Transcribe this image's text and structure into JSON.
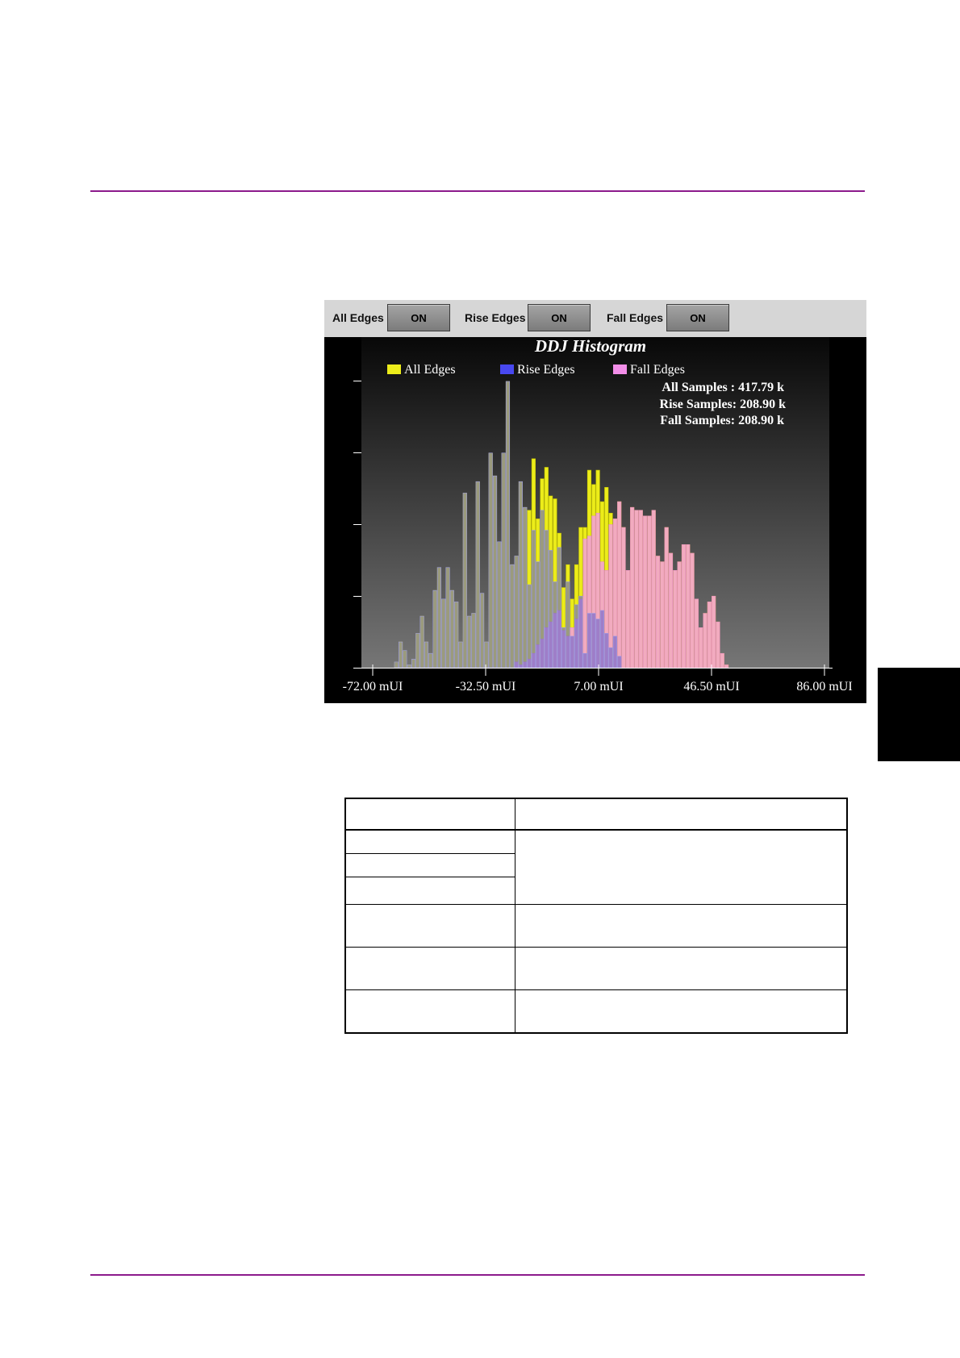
{
  "toolbar": {
    "items": [
      {
        "label": "All Edges",
        "button": "ON"
      },
      {
        "label": "Rise Edges",
        "button": "ON"
      },
      {
        "label": "Fall Edges",
        "button": "ON"
      }
    ]
  },
  "colors": {
    "all": "#ecec1a",
    "rise": "#5a5ad0",
    "fall": "#f2a8c8",
    "rule": "#8c1a8c"
  },
  "chart_data": {
    "type": "bar",
    "title": "DDJ Histogram",
    "xlabel": "",
    "ylabel": "",
    "xlim": [
      -72.0,
      86.0
    ],
    "x_ticks": [
      "-72.00 mUI",
      "-32.50 mUI",
      "7.00 mUI",
      "46.50 mUI",
      "86.00 mUI"
    ],
    "legend": {
      "placement": "top",
      "entries": [
        "All Edges",
        "Rise Edges",
        "Fall Edges"
      ]
    },
    "stats": [
      "All Samples : 417.79 k",
      "Rise Samples: 208.90 k",
      "Fall Samples: 208.90 k"
    ],
    "grid": false,
    "bin_start": -64.5,
    "bin_width": 1.5,
    "series": [
      {
        "name": "All Edges",
        "values": [
          2,
          9,
          6,
          1,
          3,
          12,
          18,
          9,
          5,
          27,
          35,
          24,
          35,
          27,
          23,
          9,
          61,
          18,
          19,
          65,
          26,
          9,
          75,
          67,
          44,
          75,
          100,
          36,
          39,
          65,
          56,
          55,
          73,
          52,
          66,
          70,
          60,
          59,
          47,
          28,
          36,
          24,
          36,
          49,
          49,
          69,
          64,
          69,
          58,
          63,
          54,
          52,
          58,
          49,
          34,
          56,
          55,
          55,
          53,
          53,
          55,
          39,
          37,
          49,
          40,
          34,
          37,
          43,
          43,
          40,
          24,
          14,
          19,
          23,
          25,
          16,
          5,
          1
        ]
      },
      {
        "name": "Rise Edges",
        "values": [
          2,
          9,
          6,
          1,
          3,
          12,
          18,
          9,
          5,
          27,
          35,
          24,
          35,
          27,
          23,
          9,
          61,
          18,
          19,
          65,
          26,
          9,
          75,
          67,
          44,
          75,
          100,
          36,
          39,
          65,
          56,
          29,
          48,
          37,
          55,
          48,
          41,
          30,
          42,
          14,
          30,
          11,
          22,
          25,
          5,
          19,
          19,
          17,
          20,
          12,
          7,
          11,
          4,
          0,
          0,
          0,
          0,
          0,
          0,
          0,
          0,
          0,
          0,
          0,
          0,
          0,
          0,
          0,
          0,
          0,
          0,
          0,
          0,
          0,
          0,
          0,
          0,
          0
        ]
      },
      {
        "name": "Fall Edges",
        "values": [
          0,
          0,
          0,
          0,
          0,
          0,
          0,
          0,
          0,
          0,
          0,
          0,
          0,
          0,
          0,
          0,
          0,
          0,
          0,
          0,
          0,
          0,
          0,
          0,
          0,
          0,
          0,
          0,
          2,
          1,
          2,
          3,
          5,
          8,
          10,
          14,
          16,
          19,
          20,
          13,
          11,
          14,
          17,
          24,
          45,
          46,
          53,
          54,
          37,
          34,
          50,
          52,
          58,
          49,
          34,
          56,
          55,
          55,
          53,
          53,
          55,
          39,
          37,
          49,
          40,
          34,
          37,
          43,
          43,
          40,
          24,
          14,
          19,
          23,
          25,
          16,
          5,
          1
        ]
      }
    ]
  }
}
